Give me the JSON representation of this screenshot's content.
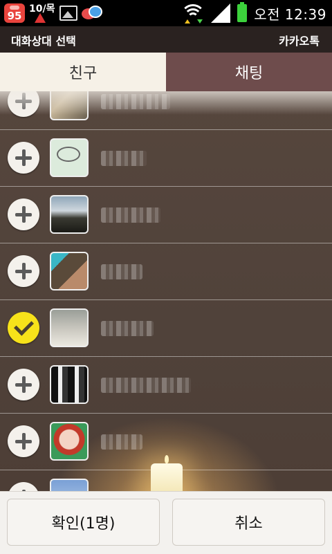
{
  "status_bar": {
    "badge_count": "95",
    "calendar_date": "10/목",
    "time": "오전 12:39",
    "icons": [
      "notification-badge-icon",
      "calendar-icon",
      "gallery-icon",
      "kakaotalk-icon",
      "wifi-icon",
      "signal-icon",
      "battery-icon"
    ]
  },
  "title_bar": {
    "title": "대화상대 선택",
    "app_name": "카카오톡"
  },
  "tabs": [
    {
      "label": "친구",
      "active": true
    },
    {
      "label": "채팅",
      "active": false
    }
  ],
  "contacts": [
    {
      "selected": false
    },
    {
      "selected": false
    },
    {
      "selected": false
    },
    {
      "selected": false
    },
    {
      "selected": true
    },
    {
      "selected": false
    },
    {
      "selected": false
    },
    {
      "selected": false
    }
  ],
  "bottom_bar": {
    "confirm_label": "확인(1명)",
    "cancel_label": "취소"
  },
  "colors": {
    "active_tab_bg": "#f6f1e7",
    "inactive_tab_bg": "#6e4c4c",
    "selected_check": "#f7e21a"
  }
}
